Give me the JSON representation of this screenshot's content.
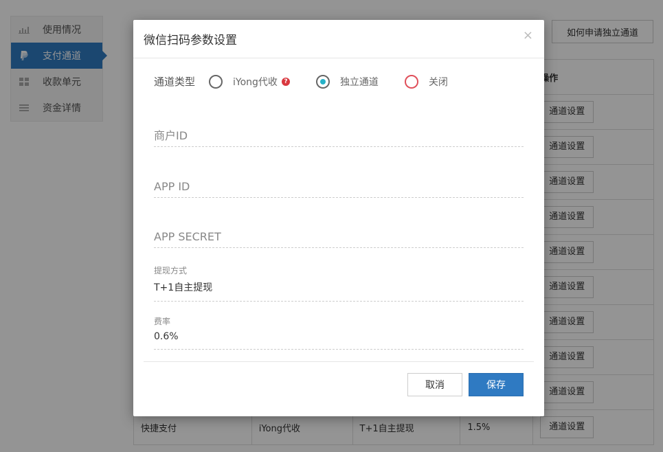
{
  "sidebar": {
    "items": [
      {
        "label": "使用情况",
        "icon": "bar-chart-icon",
        "active": false
      },
      {
        "label": "支付通道",
        "icon": "paypal-icon",
        "active": true
      },
      {
        "label": "收款单元",
        "icon": "grid-icon",
        "active": false
      },
      {
        "label": "资金详情",
        "icon": "list-icon",
        "active": false
      }
    ]
  },
  "header": {
    "apply_button": "如何申请独立通道"
  },
  "table": {
    "header_action": "操作",
    "button_label": "通道设置",
    "last_row": [
      "快捷支付",
      "iYong代收",
      "T+1自主提现",
      "1.5%"
    ]
  },
  "modal": {
    "title": "微信扫码参数设置",
    "close": "×",
    "channel_label": "通道类型",
    "options": [
      "iYong代收",
      "独立通道",
      "关闭"
    ],
    "selected": "独立通道",
    "fields": {
      "merchant_id": "商户ID",
      "app_id": "APP ID",
      "app_secret": "APP SECRET"
    },
    "withdraw": {
      "label": "提现方式",
      "value": "T+1自主提现"
    },
    "rate": {
      "label": "费率",
      "value": "0.6%"
    },
    "cancel": "取消",
    "save": "保存"
  },
  "colors": {
    "primary": "#2f7ac2",
    "radio_checked": "#27b2c8",
    "danger": "#e04f5a"
  }
}
